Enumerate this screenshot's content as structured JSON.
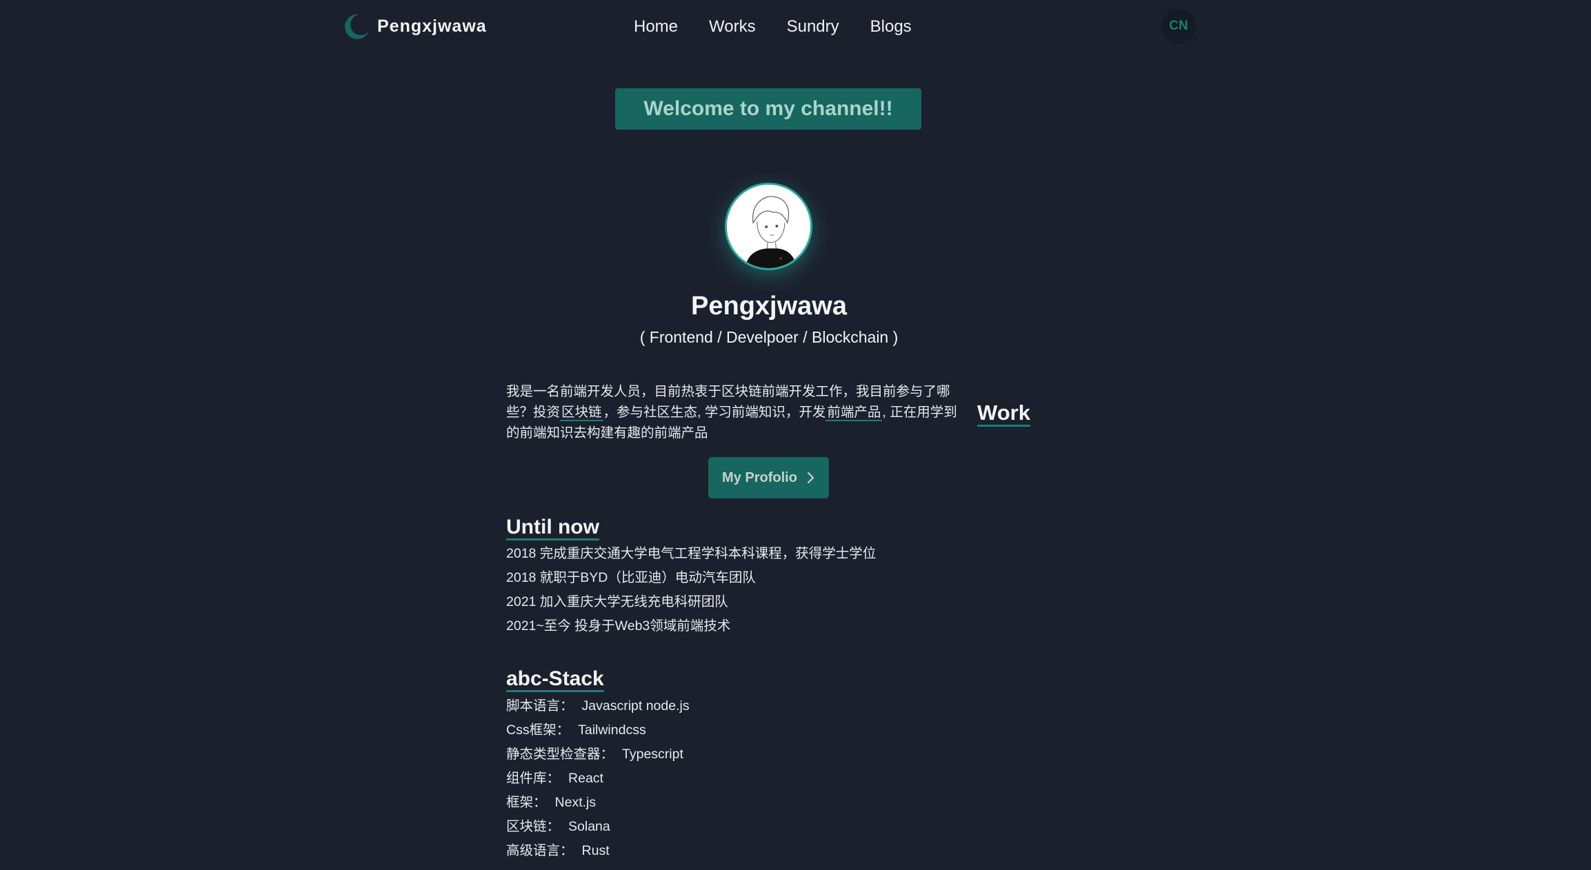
{
  "nav": {
    "brand": "Pengxjwawa",
    "links": [
      "Home",
      "Works",
      "Sundry",
      "Blogs"
    ],
    "lang_toggle": "CN"
  },
  "welcome": "Welcome to my channel!!",
  "profile": {
    "name": "Pengxjwawa",
    "roles": "( Frontend / Develpoer / Blockchain )"
  },
  "bio": {
    "part1": "我是一名前端开发人员，目前热衷于区块链前端开发工作，我目前参与了哪些？投资",
    "link1": "区块链",
    "part2": "，参与社区生态, 学习前端知识，开发",
    "link2": "前端产品",
    "part3": ", 正在用学到的前端知识去构建有趣的前端产品"
  },
  "work_link": "Work",
  "portfolio_button": "My Profolio",
  "until_now": {
    "title": "Until now",
    "items": [
      "2018 完成重庆交通大学电气工程学科本科课程，获得学士学位",
      "2018 就职于BYD（比亚迪）电动汽车团队",
      "2021 加入重庆大学无线充电科研团队",
      "2021~至今 投身于Web3领域前端技术"
    ]
  },
  "stack": {
    "title": "abc-Stack",
    "items": [
      {
        "label": "脚本语言：",
        "value": "Javascript node.js"
      },
      {
        "label": "Css框架：",
        "value": "Tailwindcss"
      },
      {
        "label": "静态类型检查器：",
        "value": "Typescript"
      },
      {
        "label": "组件库：",
        "value": "React"
      },
      {
        "label": "框架：",
        "value": "Next.js"
      },
      {
        "label": "区块链：",
        "value": "Solana"
      },
      {
        "label": "高级语言：",
        "value": "Rust"
      }
    ]
  },
  "colors": {
    "background": "#1b202d",
    "accent": "#17665f",
    "accent_text": "#18806f"
  },
  "icons": [
    "moon-icon",
    "chevron-right-icon"
  ]
}
